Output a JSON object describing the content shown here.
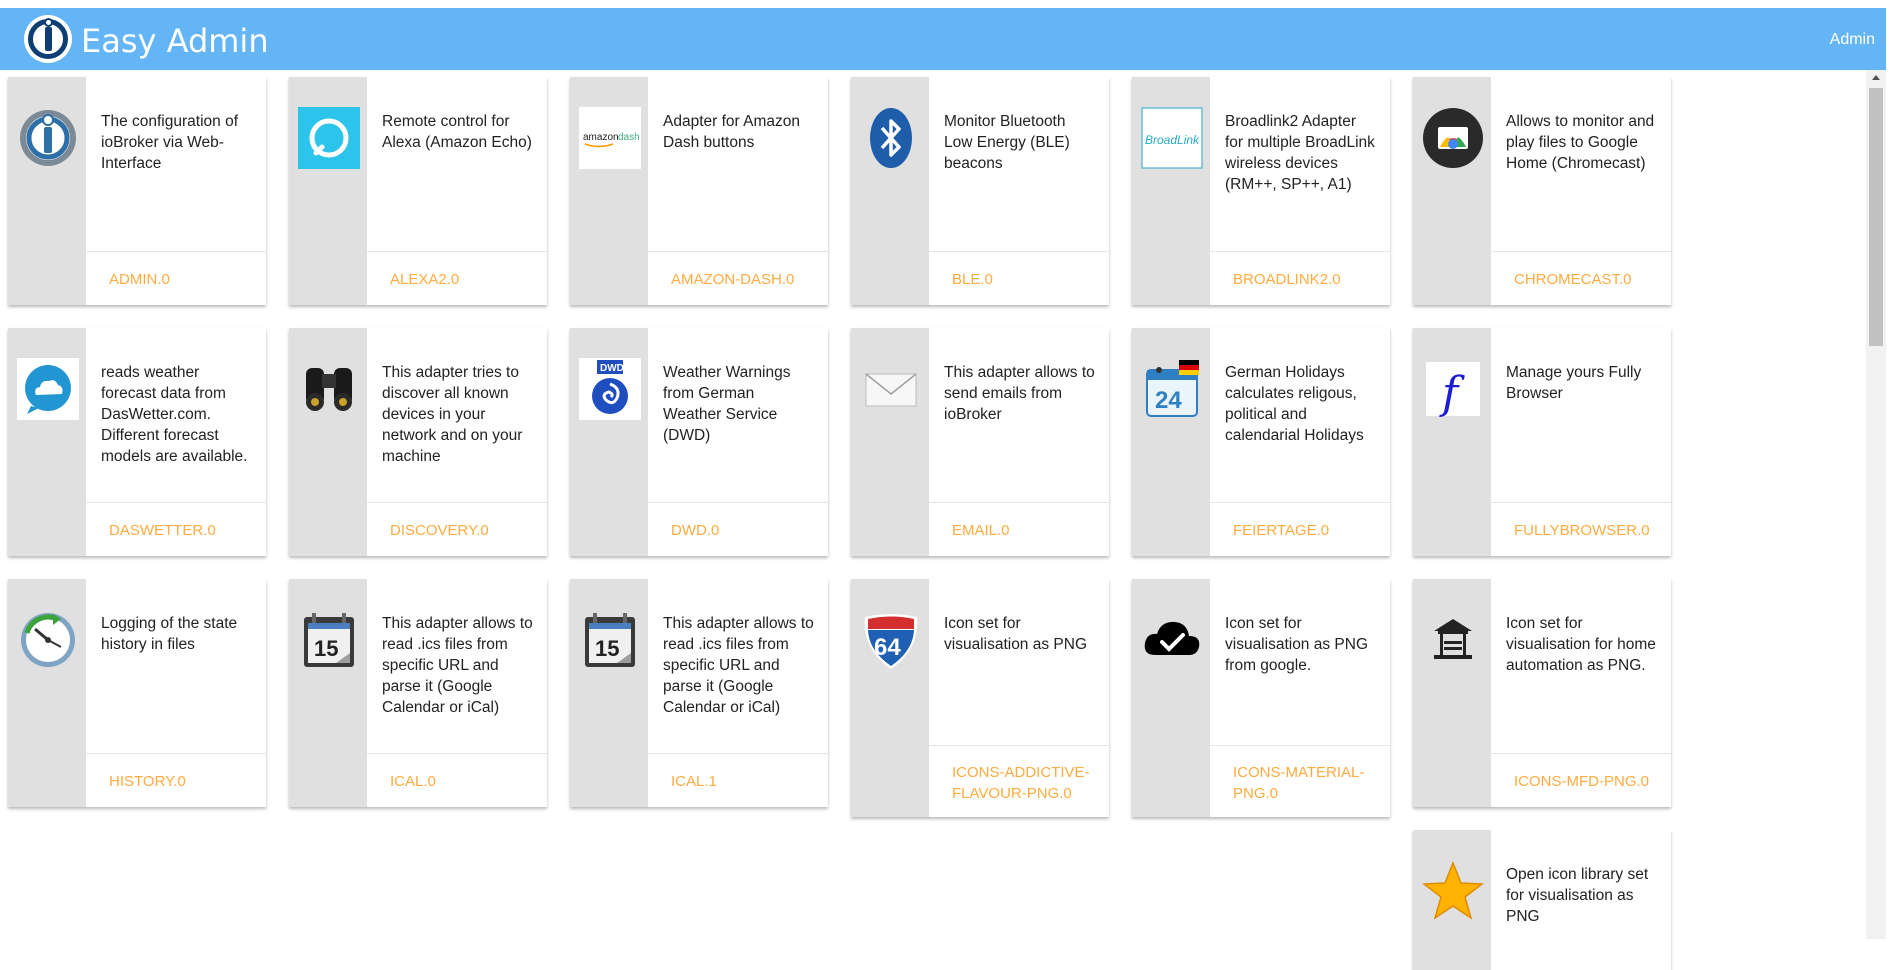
{
  "app": {
    "title": "Easy Admin",
    "user": "Admin"
  },
  "adapters": [
    {
      "id": "ADMIN.0",
      "desc": "The configuration of ioBroker via Web-Interface",
      "icon": "iobroker-logo-icon"
    },
    {
      "id": "ALEXA2.0",
      "desc": "Remote control for Alexa (Amazon Echo)",
      "icon": "alexa-icon"
    },
    {
      "id": "AMAZON-DASH.0",
      "desc": "Adapter for Amazon Dash buttons",
      "icon": "amazon-dash-icon",
      "icon_text": "amazon dash"
    },
    {
      "id": "BLE.0",
      "desc": "Monitor Bluetooth Low Energy (BLE) beacons",
      "icon": "bluetooth-icon"
    },
    {
      "id": "BROADLINK2.0",
      "desc": "Broadlink2 Adapter for multiple BroadLink wireless devices (RM++, SP++, A1)",
      "icon": "broadlink-icon",
      "icon_text": "BroadLink"
    },
    {
      "id": "CHROMECAST.0",
      "desc": "Allows to monitor and play files to Google Home (Chromecast)",
      "icon": "chromecast-icon"
    },
    {
      "id": "DASWETTER.0",
      "desc": "reads weather forecast data from DasWetter.com. Different forecast models are available.",
      "icon": "weather-cloud-icon"
    },
    {
      "id": "DISCOVERY.0",
      "desc": "This adapter tries to discover all known devices in your network and on your machine",
      "icon": "binoculars-icon"
    },
    {
      "id": "DWD.0",
      "desc": "Weather Warnings from German Weather Service (DWD)",
      "icon": "dwd-icon",
      "icon_text": "DWD"
    },
    {
      "id": "EMAIL.0",
      "desc": "This adapter allows to send emails from ioBroker",
      "icon": "envelope-icon"
    },
    {
      "id": "FEIERTAGE.0",
      "desc": "German Holidays calculates religous, political and calendarial Holidays",
      "icon": "calendar-24-icon",
      "icon_text": "24"
    },
    {
      "id": "FULLYBROWSER.0",
      "desc": "Manage yours Fully Browser",
      "icon": "fully-browser-icon",
      "icon_text": "f"
    },
    {
      "id": "HISTORY.0",
      "desc": "Logging of the state history in files",
      "icon": "history-clock-icon"
    },
    {
      "id": "ICAL.0",
      "desc": "This adapter allows to read .ics files from specific URL and parse it (Google Calendar or iCal)",
      "icon": "ical-calendar-icon",
      "icon_text": "15"
    },
    {
      "id": "ICAL.1",
      "desc": "This adapter allows to read .ics files from specific URL and parse it (Google Calendar or iCal)",
      "icon": "ical-calendar-icon",
      "icon_text": "15"
    },
    {
      "id": "ICONS-ADDICTIVE-FLAVOUR-PNG.0",
      "desc": "Icon set for visualisation as PNG",
      "icon": "interstate-shield-icon",
      "icon_text": "64"
    },
    {
      "id": "ICONS-MATERIAL-PNG.0",
      "desc": "Icon set for visualisation as PNG from google.",
      "icon": "cloud-check-icon"
    },
    {
      "id": "ICONS-MFD-PNG.0",
      "desc": "Icon set for visualisation for home automation as PNG.",
      "icon": "gazebo-icon"
    },
    {
      "id": "",
      "desc": "Open icon library set for visualisation as PNG",
      "icon": "star-icon"
    }
  ]
}
